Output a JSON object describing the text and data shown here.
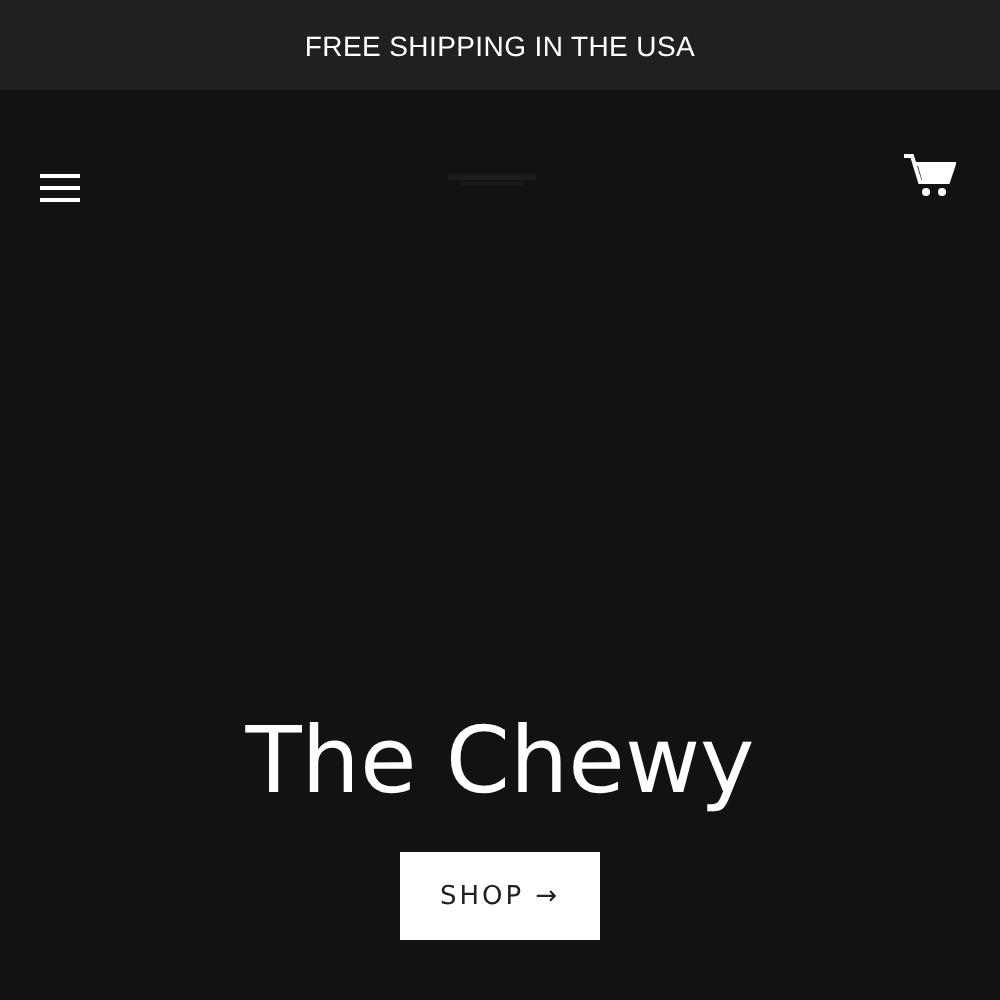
{
  "announcement": "FREE SHIPPING IN THE USA",
  "hero": {
    "title": "The Chewy",
    "button": {
      "label": "SHOP",
      "arrow": "→"
    }
  }
}
